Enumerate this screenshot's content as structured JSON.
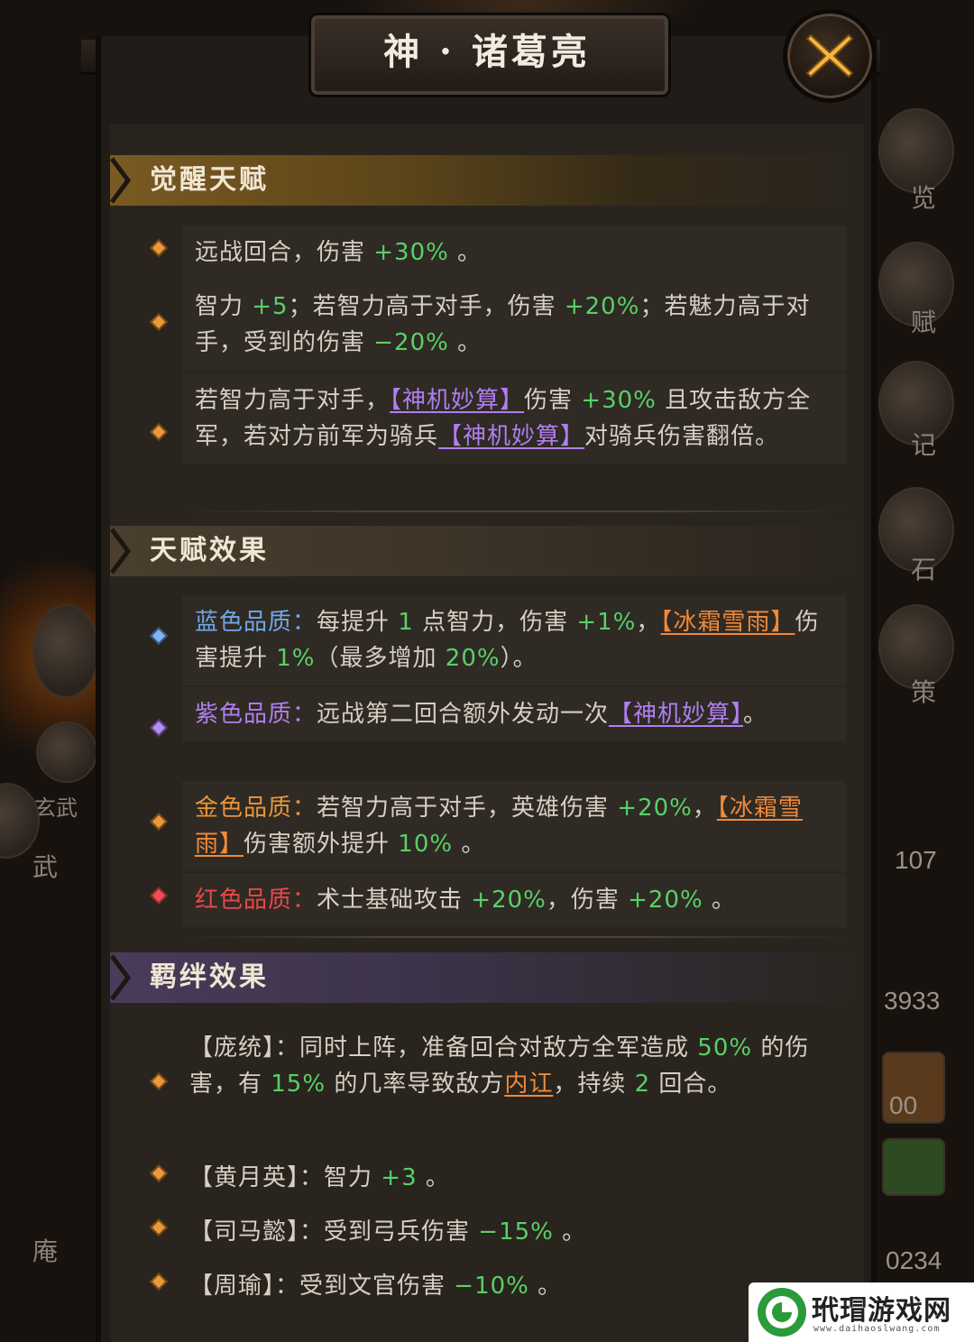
{
  "title": "神 · 诸葛亮",
  "background": {
    "side_labels": [
      "览",
      "赋",
      "记",
      "石",
      "策",
      "玄武",
      "武",
      "庵"
    ],
    "side_numbers": [
      "107",
      "3933",
      "00",
      "0234"
    ]
  },
  "sections": {
    "awakening": {
      "header": "觉醒天赋",
      "rows": [
        {
          "parts": [
            "远战回合，伤害 ",
            "+30%",
            " 。"
          ]
        },
        {
          "parts": [
            "智力 ",
            "+5",
            "；若智力高于对手，伤害 ",
            "+20%",
            "；若魅力高于对手，受到的伤害 ",
            "−20%",
            " 。"
          ]
        },
        {
          "parts": [
            "若智力高于对手，",
            "【神机妙算】",
            "伤害 ",
            "+30%",
            " 且攻击敌方全军，若对方前军为骑兵",
            "【神机妙算】",
            "对骑兵伤害翻倍。"
          ]
        }
      ]
    },
    "talent_effect": {
      "header": "天赋效果",
      "rows": [
        {
          "quality": "蓝色品质：",
          "parts": [
            "每提升 ",
            "1",
            " 点智力，伤害 ",
            "+1%",
            "，",
            "【冰霜雪雨】",
            "伤害提升 ",
            "1%",
            "（最多增加 ",
            "20%",
            "）。"
          ]
        },
        {
          "quality": "紫色品质：",
          "parts": [
            "远战第二回合额外发动一次",
            "【神机妙算】",
            "。"
          ]
        },
        {
          "quality": "金色品质：",
          "parts": [
            "若智力高于对手，英雄伤害 ",
            "+20%",
            "，",
            "【冰霜雪雨】",
            "伤害额外提升 ",
            "10%",
            " 。"
          ]
        },
        {
          "quality": "红色品质：",
          "parts": [
            "术士基础攻击 ",
            "+20%",
            "，伤害 ",
            "+20%",
            " 。"
          ]
        }
      ]
    },
    "bond_effect": {
      "header": "羁绊效果",
      "rows": [
        {
          "parts": [
            "【庞统】",
            "：同时上阵，准备回合对敌方全军造成 ",
            "50%",
            " 的伤害，有 ",
            "15%",
            " 的几率导致敌方",
            "内讧",
            "，持续 ",
            "2",
            " 回合。"
          ]
        },
        {
          "parts": [
            "【黄月英】",
            "：智力 ",
            "+3",
            " 。"
          ]
        },
        {
          "parts": [
            "【司马懿】",
            "：受到弓兵伤害 ",
            "−15%",
            " 。"
          ]
        },
        {
          "parts": [
            "【周瑜】",
            "：受到文官伤害 ",
            "−10%",
            " 。"
          ]
        }
      ]
    }
  },
  "watermark": {
    "name": "玳瑁游戏网",
    "url": "www.daihaoslwang.com"
  },
  "colors": {
    "green": "#58d068",
    "purple": "#b07ef0",
    "orange": "#f08a3a",
    "blue": "#6fa8e8",
    "gold": "#e8963a",
    "red": "#e84848"
  }
}
